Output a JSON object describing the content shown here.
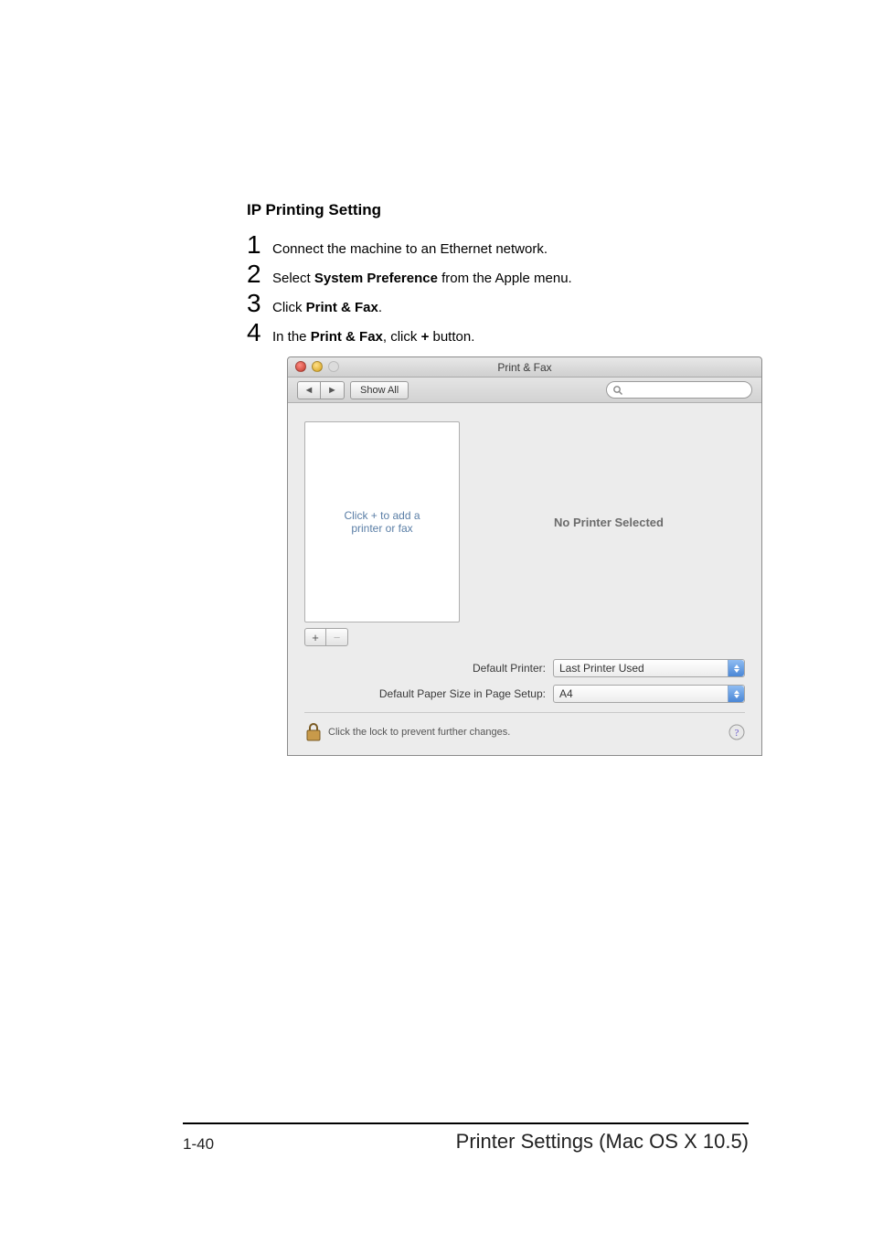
{
  "heading": "IP Printing Setting",
  "steps": [
    {
      "num": "1",
      "text_before": "Connect the machine to an Ethernet network.",
      "bold1": "",
      "text_mid": "",
      "bold2": "",
      "text_after": ""
    },
    {
      "num": "2",
      "text_before": "Select ",
      "bold1": "System Preference",
      "text_mid": " from the Apple menu.",
      "bold2": "",
      "text_after": ""
    },
    {
      "num": "3",
      "text_before": "Click ",
      "bold1": "Print & Fax",
      "text_mid": ".",
      "bold2": "",
      "text_after": ""
    },
    {
      "num": "4",
      "text_before": "In the ",
      "bold1": "Print & Fax",
      "text_mid": ", click ",
      "bold2": "+",
      "text_after": " button."
    }
  ],
  "window": {
    "title": "Print & Fax",
    "show_all": "Show All",
    "printer_list_placeholder": "Click + to add a\nprinter or fax",
    "no_printer": "No Printer Selected",
    "default_printer_label": "Default Printer:",
    "default_printer_value": "Last Printer Used",
    "paper_size_label": "Default Paper Size in Page Setup:",
    "paper_size_value": "A4",
    "lock_text": "Click the lock to prevent further changes.",
    "add_symbol": "+",
    "remove_symbol": "−",
    "nav_back": "◄",
    "nav_fwd": "►"
  },
  "footer": {
    "page": "1-40",
    "section": "Printer Settings (Mac OS X 10.5)"
  }
}
